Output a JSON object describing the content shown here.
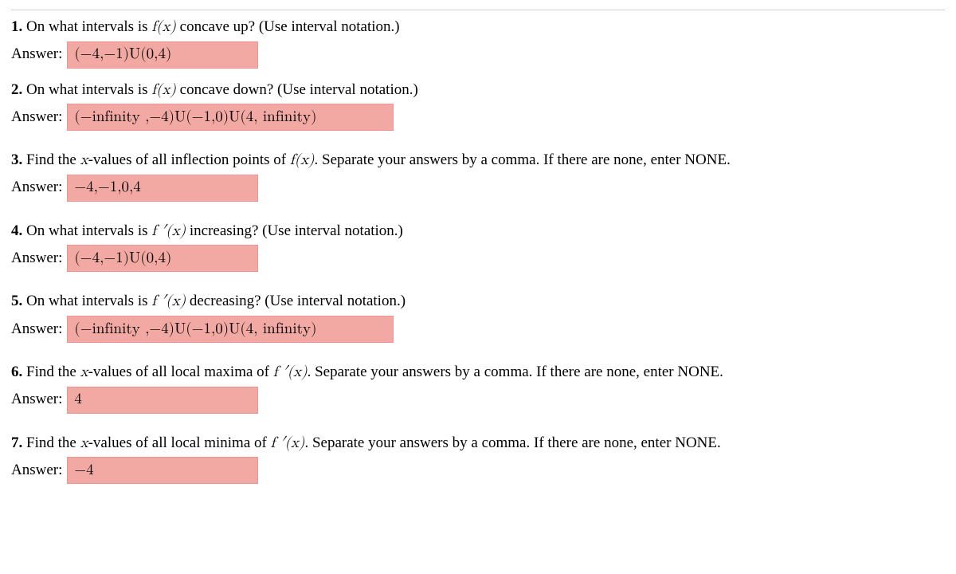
{
  "questions": [
    {
      "num": "1.",
      "prefix": "On what intervals is ",
      "fn": "f(x)",
      "suffix": " concave up? (Use interval notation.)",
      "answer_label": "Answer:",
      "answer_value": "(−4,−1)U(0,4)",
      "wide": false
    },
    {
      "num": "2.",
      "prefix": "On what intervals is ",
      "fn": "f(x)",
      "suffix": " concave down? (Use interval notation.)",
      "answer_label": "Answer:",
      "answer_value": "(−infinity ,−4)U(−1,0)U(4, infinity)",
      "wide": true
    },
    {
      "num": "3.",
      "prefix": "Find the ",
      "var": "x",
      "mid": "-values of all inflection points of ",
      "fn": "f(x)",
      "suffix": ". Separate your answers by a comma. If there are none, enter NONE.",
      "answer_label": "Answer:",
      "answer_value": "−4,−1,0,4",
      "wide": false
    },
    {
      "num": "4.",
      "prefix": "On what intervals is ",
      "fn": "f ′(x)",
      "suffix": " increasing? (Use interval notation.)",
      "answer_label": "Answer:",
      "answer_value": "(−4,−1)U(0,4)",
      "wide": false
    },
    {
      "num": "5.",
      "prefix": "On what intervals is ",
      "fn": "f ′(x)",
      "suffix": " decreasing? (Use interval notation.)",
      "answer_label": "Answer:",
      "answer_value": "(−infinity ,−4)U(−1,0)U(4, infinity)",
      "wide": true
    },
    {
      "num": "6.",
      "prefix": "Find the ",
      "var": "x",
      "mid": "-values of all local maxima of ",
      "fn": "f ′(x)",
      "suffix": ". Separate your answers by a comma. If there are none, enter NONE.",
      "answer_label": "Answer:",
      "answer_value": "4",
      "wide": false
    },
    {
      "num": "7.",
      "prefix": "Find the ",
      "var": "x",
      "mid": "-values of all local minima of ",
      "fn": "f ′(x)",
      "suffix": ". Separate your answers by a comma. If there are none, enter NONE.",
      "answer_label": "Answer:",
      "answer_value": "−4",
      "wide": false
    }
  ]
}
